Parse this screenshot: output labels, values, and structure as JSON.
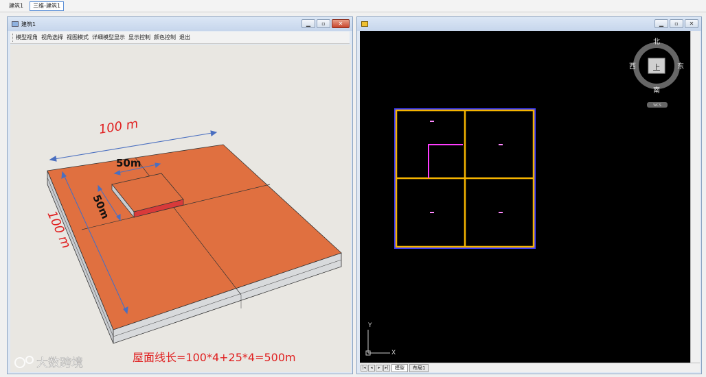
{
  "doc_tabs": [
    "建筑1",
    "三维-建筑1"
  ],
  "left_window": {
    "title": "建筑1",
    "menu": [
      "模型视角",
      "视角选择",
      "视图模式",
      "详细模型显示",
      "显示控制",
      "颜色控制",
      "退出"
    ],
    "annotations": {
      "top_length": "100 m",
      "side_length": "100 m",
      "small_top": "50m",
      "small_side": "50m",
      "formula": "屋面线长=100*4+25*4=500m"
    },
    "watermark": "大数跨境"
  },
  "right_window": {
    "compass": {
      "north": "北",
      "south": "南",
      "east": "东",
      "west": "西",
      "center": "上",
      "wcs": "WCS"
    },
    "axis": {
      "x": "X",
      "y": "Y"
    },
    "layout_tabs": [
      "模型",
      "布局1"
    ]
  },
  "colors": {
    "roof": "#e07040",
    "cad_frame": "#f5b400",
    "cad_outer": "#3a3aff",
    "cad_magenta": "#ff3cff",
    "dimension_arrow": "#4a6fc0",
    "red_text": "#e02020"
  }
}
